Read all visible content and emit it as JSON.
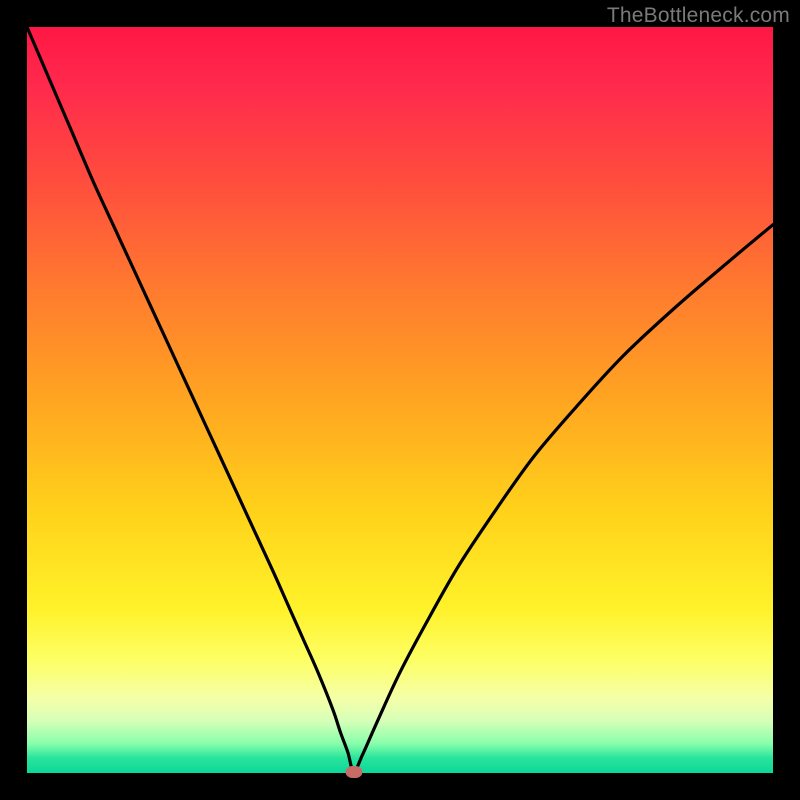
{
  "watermark": "TheBottleneck.com",
  "colors": {
    "frame": "#000000",
    "curve": "#000000",
    "marker": "#c66b66"
  },
  "chart_data": {
    "type": "line",
    "title": "",
    "xlabel": "",
    "ylabel": "",
    "xlim": [
      0,
      100
    ],
    "ylim": [
      0,
      100
    ],
    "grid": false,
    "legend": false,
    "series": [
      {
        "name": "bottleneck-curve",
        "x": [
          0,
          3,
          6,
          9,
          12,
          15,
          18,
          21,
          24,
          27,
          30,
          33,
          35,
          37,
          39,
          41,
          42,
          43,
          43.8,
          45,
          47,
          50,
          54,
          58,
          63,
          68,
          74,
          80,
          87,
          94,
          100
        ],
        "y": [
          100,
          93,
          86,
          79,
          72.5,
          66,
          59.5,
          53,
          46.5,
          40,
          33.5,
          27,
          22.5,
          18,
          13.5,
          8.5,
          5.5,
          2.8,
          0.2,
          2.5,
          7,
          13.5,
          21,
          28,
          35.5,
          42.5,
          49.5,
          56,
          62.5,
          68.5,
          73.5
        ]
      }
    ],
    "marker": {
      "x": 43.8,
      "y": 0.2
    }
  }
}
